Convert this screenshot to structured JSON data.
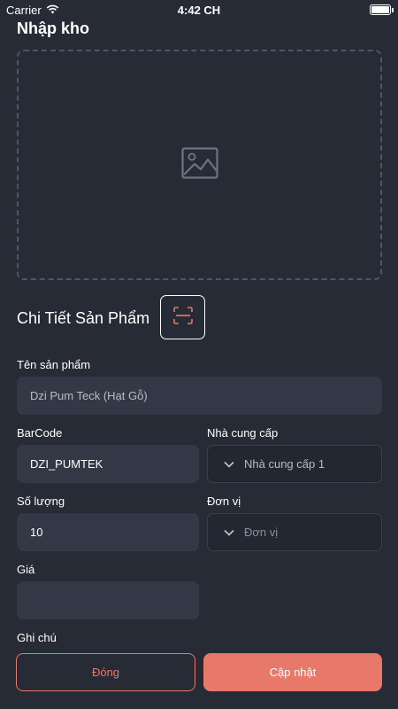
{
  "status_bar": {
    "carrier": "Carrier",
    "time": "4:42 CH"
  },
  "header": {
    "title": "Nhập kho"
  },
  "image_area": {
    "icon": "image-placeholder-icon"
  },
  "section": {
    "title": "Chi Tiết Sản Phẩm",
    "scan_icon": "scan-icon"
  },
  "form": {
    "product_name": {
      "label": "Tên sản phẩm",
      "value": "Dzi Pum Teck (Hạt Gỗ)"
    },
    "barcode": {
      "label": "BarCode",
      "value": "DZI_PUMTEK"
    },
    "supplier": {
      "label": "Nhà cung cấp",
      "value": "Nhà cung cấp 1"
    },
    "quantity": {
      "label": "Số lượng",
      "value": "10"
    },
    "unit": {
      "label": "Đơn vị",
      "placeholder": "Đơn vị"
    },
    "price": {
      "label": "Giá",
      "value": ""
    },
    "note": {
      "label": "Ghi chú"
    }
  },
  "actions": {
    "close_label": "Đóng",
    "update_label": "Cập nhật"
  },
  "colors": {
    "background": "#272b35",
    "field": "#333846",
    "accent": "#e8796a"
  }
}
